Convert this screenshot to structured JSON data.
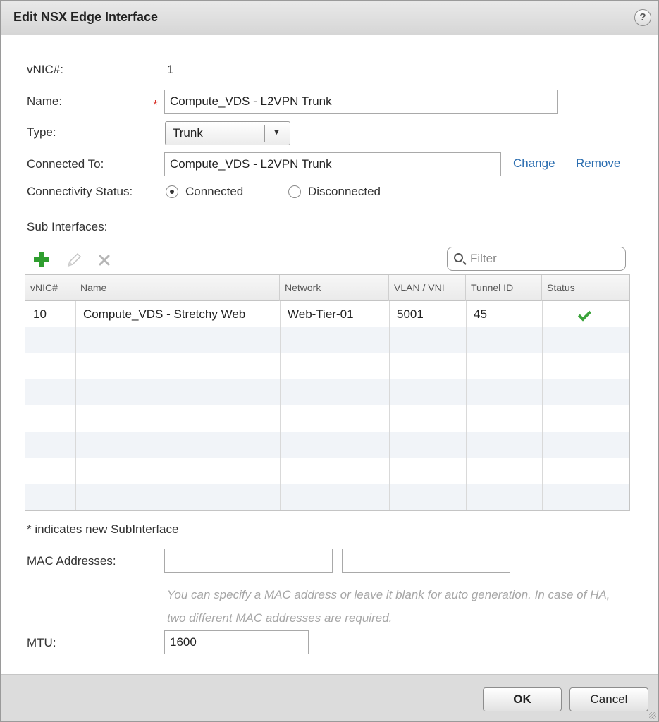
{
  "dialog": {
    "title": "Edit NSX Edge Interface",
    "help_glyph": "?"
  },
  "form": {
    "vnic_label": "vNIC#:",
    "vnic_value": "1",
    "name_label": "Name:",
    "name_required_mark": "*",
    "name_value": "Compute_VDS - L2VPN Trunk",
    "type_label": "Type:",
    "type_value": "Trunk",
    "connected_to_label": "Connected To:",
    "connected_to_value": "Compute_VDS - L2VPN Trunk",
    "change_link": "Change",
    "remove_link": "Remove",
    "connectivity_label": "Connectivity Status:",
    "connected_option": "Connected",
    "disconnected_option": "Disconnected",
    "connectivity_selected": "Connected",
    "sub_interfaces_label": "Sub Interfaces:"
  },
  "subinterfaces": {
    "filter_placeholder": "Filter",
    "columns": [
      "vNIC#",
      "Name",
      "Network",
      "VLAN / VNI",
      "Tunnel ID",
      "Status"
    ],
    "rows": [
      {
        "vnic": "10",
        "name": "Compute_VDS - Stretchy Web",
        "network": "Web-Tier-01",
        "vlan_vni": "5001",
        "tunnel_id": "45",
        "status_icon": "check-icon"
      }
    ],
    "note": "* indicates new SubInterface"
  },
  "mac": {
    "label": "MAC Addresses:",
    "value_1": "",
    "value_2": "",
    "hint": "You can specify a MAC address or leave it blank for auto generation. In case of HA, two different MAC addresses are required."
  },
  "mtu": {
    "label": "MTU:",
    "value": "1600"
  },
  "footer": {
    "ok_label": "OK",
    "cancel_label": "Cancel"
  },
  "colors": {
    "title_bar": "#dedede",
    "link": "#2a6db0",
    "required": "#d9342b",
    "add_icon": "#2f9e2f",
    "status_ok": "#3aa33a",
    "footer": "#dcdcdc"
  }
}
